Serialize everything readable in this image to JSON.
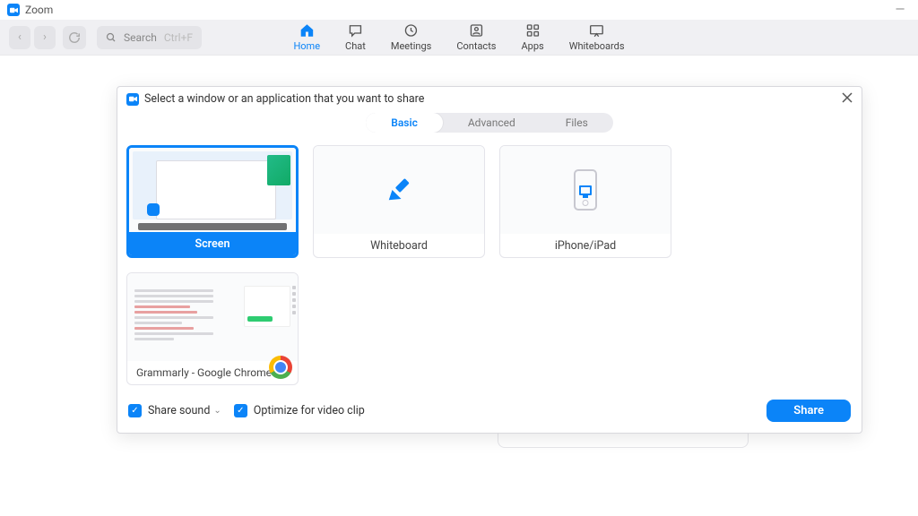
{
  "titlebar": {
    "app_name": "Zoom"
  },
  "toolbar": {
    "search_placeholder": "Search",
    "search_shortcut": "Ctrl+F",
    "nav": [
      {
        "key": "home",
        "label": "Home",
        "active": true
      },
      {
        "key": "chat",
        "label": "Chat"
      },
      {
        "key": "meetings",
        "label": "Meetings"
      },
      {
        "key": "contacts",
        "label": "Contacts"
      },
      {
        "key": "apps",
        "label": "Apps"
      },
      {
        "key": "whiteboards",
        "label": "Whiteboards"
      }
    ]
  },
  "share_dialog": {
    "title": "Select a window or an application that you want to share",
    "tabs": {
      "basic": "Basic",
      "advanced": "Advanced",
      "files": "Files",
      "active": "basic"
    },
    "options": {
      "screen": {
        "label": "Screen",
        "selected": true
      },
      "whiteboard": {
        "label": "Whiteboard"
      },
      "iphone": {
        "label": "iPhone/iPad"
      },
      "app1": {
        "label": "Grammarly - Google Chrome",
        "app_icon": "chrome"
      }
    },
    "footer": {
      "share_sound": {
        "label": "Share sound",
        "checked": true,
        "has_dropdown": true
      },
      "optimize": {
        "label": "Optimize for video clip",
        "checked": true
      },
      "share_button": "Share"
    }
  }
}
